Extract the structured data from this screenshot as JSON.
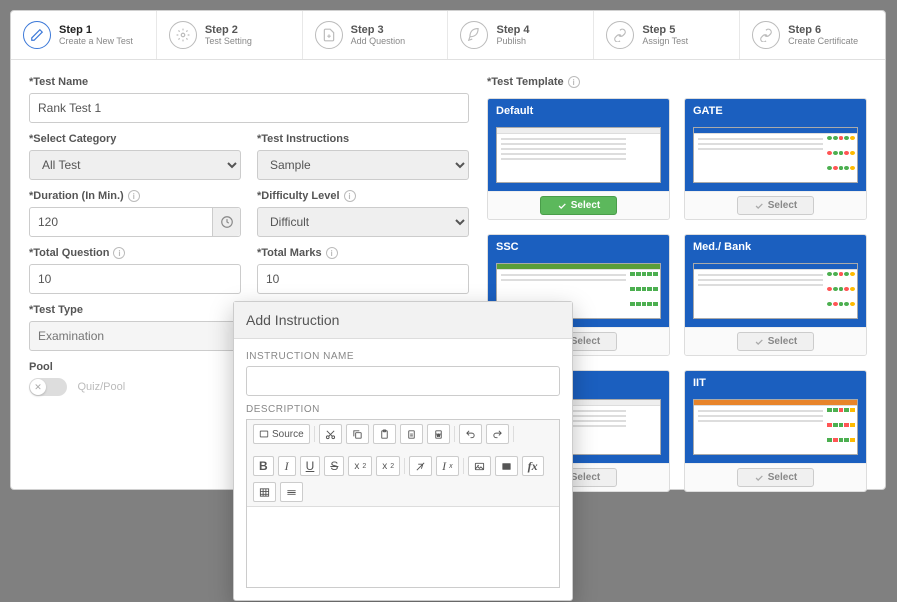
{
  "steps": [
    {
      "title": "Step 1",
      "sub": "Create a New Test"
    },
    {
      "title": "Step 2",
      "sub": "Test Setting"
    },
    {
      "title": "Step 3",
      "sub": "Add Question"
    },
    {
      "title": "Step 4",
      "sub": "Publish"
    },
    {
      "title": "Step 5",
      "sub": "Assign Test"
    },
    {
      "title": "Step 6",
      "sub": "Create Certificate"
    }
  ],
  "form": {
    "test_name_label": "*Test Name",
    "test_name": "Rank Test 1",
    "category_label": "*Select Category",
    "category": "All Test",
    "instructions_label": "*Test Instructions",
    "instructions": "Sample",
    "duration_label": "*Duration (In Min.)",
    "duration": "120",
    "difficulty_label": "*Difficulty Level",
    "difficulty": "Difficult",
    "total_q_label": "*Total Question",
    "total_q": "10",
    "total_m_label": "*Total Marks",
    "total_m": "10",
    "test_type_label": "*Test Type",
    "test_type_placeholder": "Examination",
    "pool_label": "Pool",
    "pool_toggle": "Quiz/Pool"
  },
  "templates": {
    "label": "*Test Template",
    "items": [
      {
        "name": "Default",
        "selected": true
      },
      {
        "name": "GATE",
        "selected": false
      },
      {
        "name": "SSC",
        "selected": false
      },
      {
        "name": "Med./ Bank",
        "selected": false
      },
      {
        "name": "",
        "selected": false
      },
      {
        "name": "IIT",
        "selected": false
      }
    ],
    "select_btn": "Select"
  },
  "modal": {
    "title": "Add Instruction",
    "name_label": "INSTRUCTION NAME",
    "desc_label": "DESCRIPTION",
    "source_btn": "Source"
  }
}
